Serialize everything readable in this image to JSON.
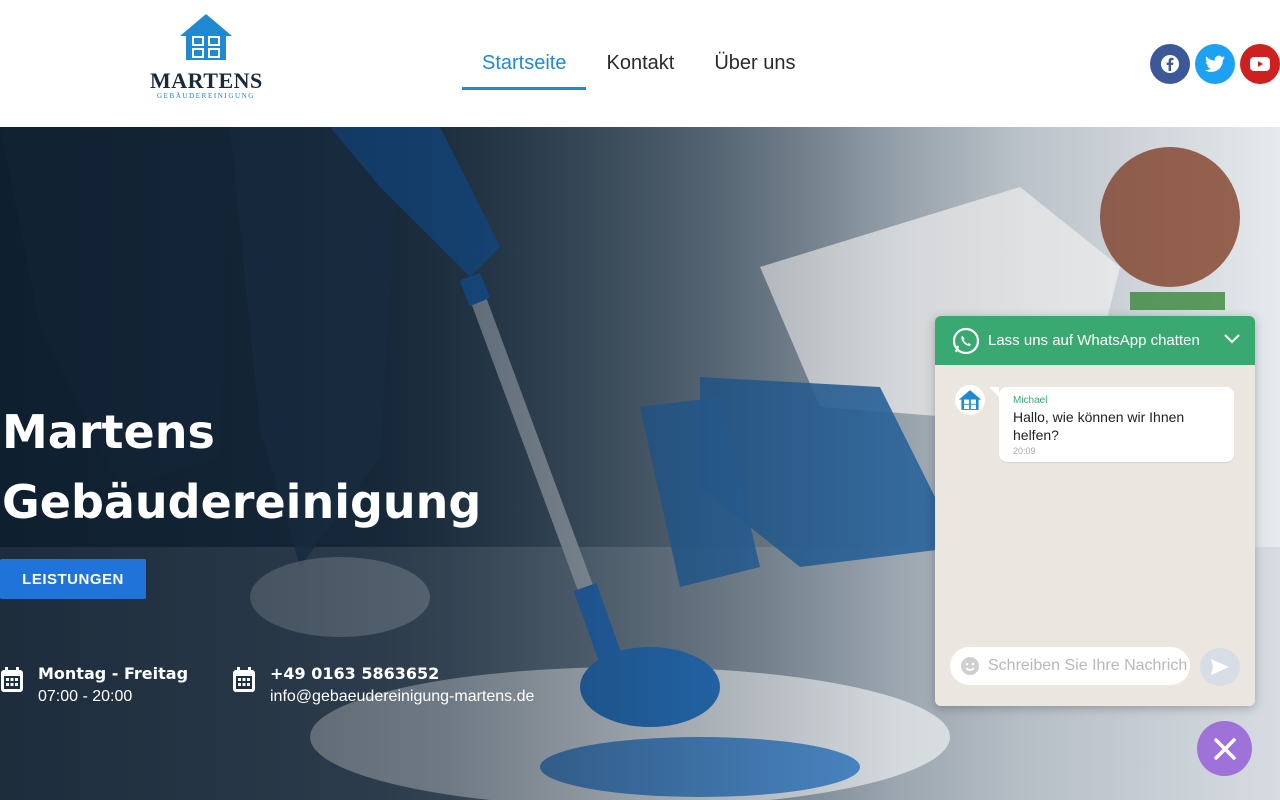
{
  "header": {
    "logo": {
      "name": "MARTENS",
      "subtitle": "GEBÄUDEREINIGUNG"
    },
    "nav": [
      {
        "label": "Startseite",
        "active": true
      },
      {
        "label": "Kontakt",
        "active": false
      },
      {
        "label": "Über uns",
        "active": false
      }
    ],
    "socials": [
      {
        "icon": "facebook-icon",
        "color": "#3b5998"
      },
      {
        "icon": "twitter-icon",
        "color": "#1da1f2"
      },
      {
        "icon": "youtube-icon",
        "color": "#cd201f"
      }
    ]
  },
  "hero": {
    "title_line1": "Martens",
    "title_line2": "Gebäudereinigung",
    "button_label": "LEISTUNGEN",
    "hours": {
      "title": "Montag - Freitag",
      "value": "07:00 - 20:00"
    },
    "contact": {
      "phone": "+49 0163 5863652",
      "email": "info@gebaeudereinigung-martens.de"
    }
  },
  "whatsapp": {
    "header_title": "Lass uns auf WhatsApp chatten",
    "message": {
      "sender": "Michael",
      "text": "Hallo, wie können wir Ihnen helfen?",
      "time": "20:09"
    },
    "input_placeholder": "Schreiben Sie Ihre Nachricht",
    "colors": {
      "header": "#3aa971",
      "close_button": "#9e72d8"
    }
  },
  "colors": {
    "accent": "#1f8ad1",
    "button": "#1f73d9"
  }
}
